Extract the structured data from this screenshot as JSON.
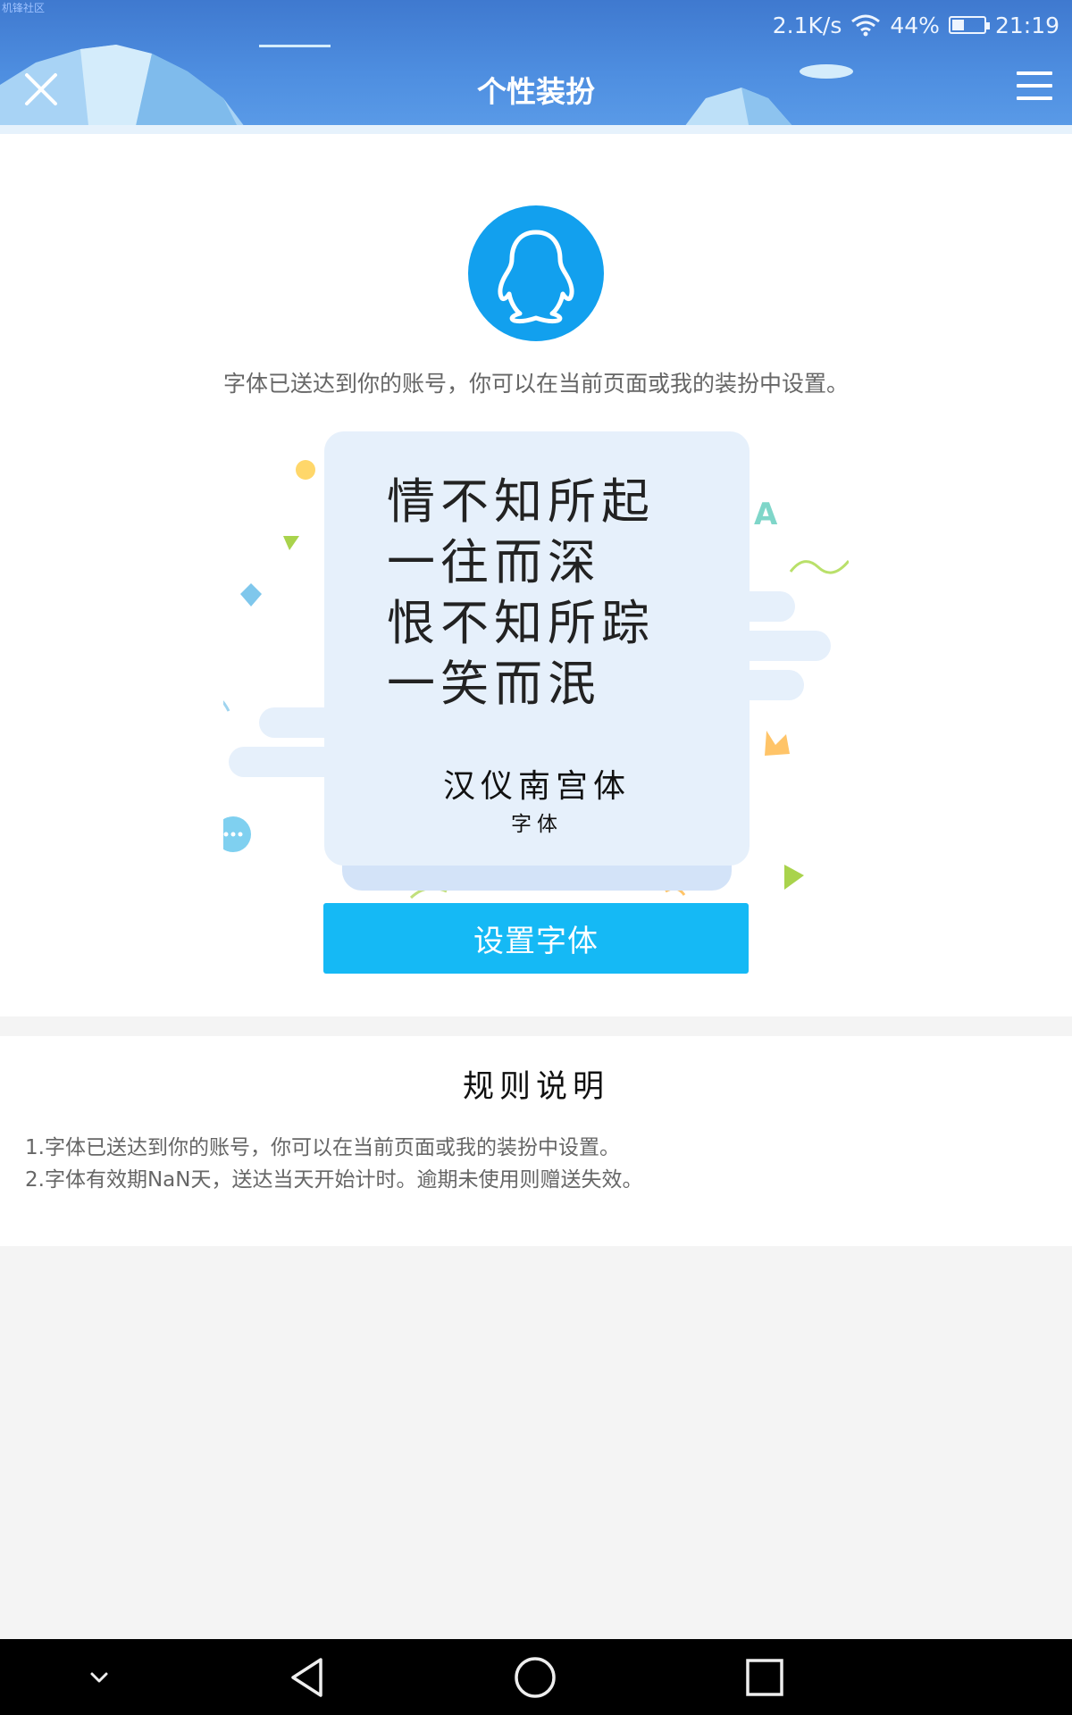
{
  "status_bar": {
    "watermark": "机锋社区",
    "speed": "2.1K/s",
    "battery_percent": "44%",
    "battery_level": 0.44,
    "time": "21:19",
    "icons": [
      "wifi-icon",
      "battery-icon"
    ]
  },
  "header": {
    "title": "个性装扮",
    "close_icon": "close-icon",
    "menu_icon": "menu-icon",
    "background_color": "#4a88dc"
  },
  "main": {
    "avatar_icon": "qq-penguin-icon",
    "avatar_color": "#12a0ee",
    "description": "字体已送达到你的账号，你可以在当前页面或我的装扮中设置。",
    "poem_lines": [
      "情不知所起",
      "一往而深",
      "恨不知所踪",
      "一笑而泯"
    ],
    "font_name": "汉仪南宫体",
    "font_type": "字体",
    "set_button": "设置字体",
    "accent_color": "#15b9f5"
  },
  "rules": {
    "title": "规则说明",
    "items": [
      "1.字体已送达到你的账号，你可以在当前页面或我的装扮中设置。",
      "2.字体有效期NaN天，送达当天开始计时。逾期未使用则赠送失效。"
    ]
  },
  "nav": {
    "icons": [
      "chevron-down-icon",
      "back-icon",
      "home-icon",
      "recent-apps-icon"
    ]
  }
}
